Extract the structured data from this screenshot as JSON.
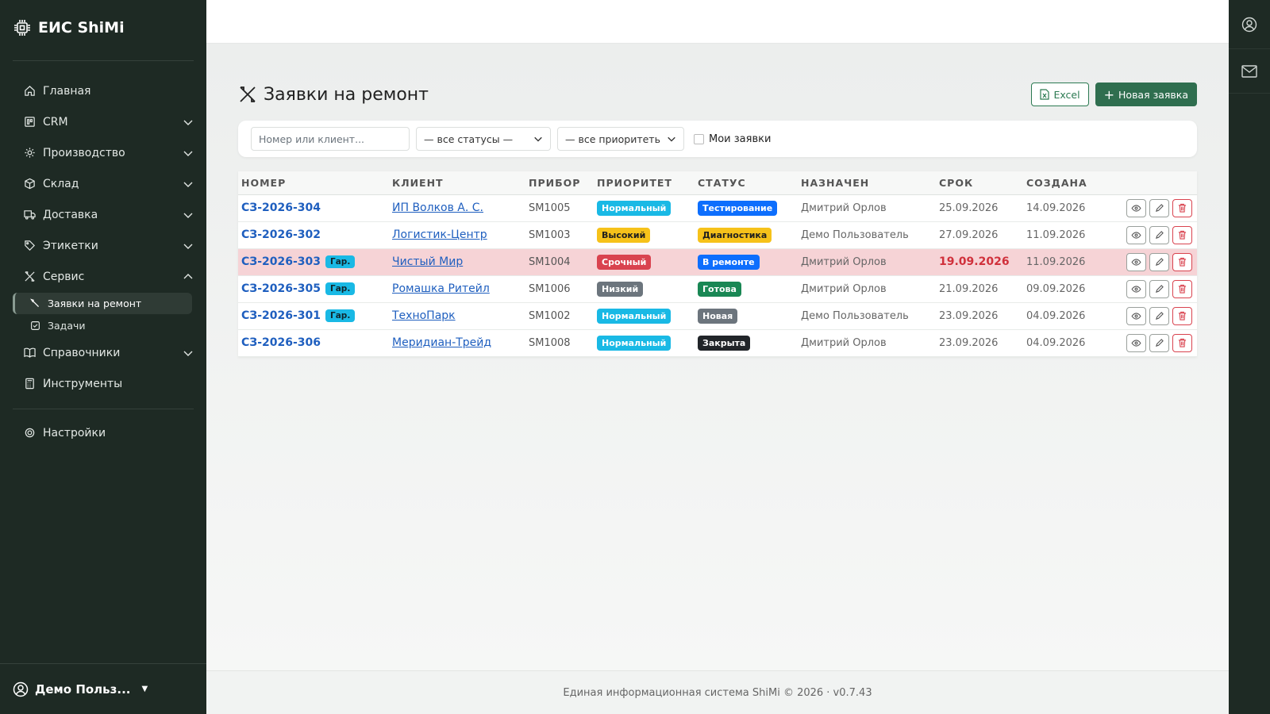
{
  "app": {
    "title": "ЕИС ShiMi"
  },
  "sidebar": {
    "items": [
      {
        "label": "Главная",
        "icon": "home-icon"
      },
      {
        "label": "CRM",
        "icon": "crm-icon"
      },
      {
        "label": "Производство",
        "icon": "gear-icon"
      },
      {
        "label": "Склад",
        "icon": "box-icon"
      },
      {
        "label": "Доставка",
        "icon": "truck-icon"
      },
      {
        "label": "Этикетки",
        "icon": "tag-icon"
      },
      {
        "label": "Сервис",
        "icon": "tools-icon"
      },
      {
        "label": "Заявки на ремонт",
        "icon": "wrench-icon"
      },
      {
        "label": "Задачи",
        "icon": "checkbox-icon"
      },
      {
        "label": "Справочники",
        "icon": "book-icon"
      },
      {
        "label": "Инструменты",
        "icon": "calculator-icon"
      },
      {
        "label": "Настройки",
        "icon": "settings-icon"
      }
    ],
    "user": "Демо Польз..."
  },
  "page": {
    "title": "Заявки на ремонт",
    "excel_label": "Excel",
    "new_label": "Новая заявка"
  },
  "filters": {
    "search_placeholder": "Номер или клиент...",
    "status": "— все статусы —",
    "priority": "— все приоритеть",
    "mine_label": "Мои заявки"
  },
  "table": {
    "headers": [
      "НОМЕР",
      "КЛИЕНТ",
      "ПРИБОР",
      "ПРИОРИТЕТ",
      "СТАТУС",
      "НАЗНАЧЕН",
      "СРОК",
      "СОЗДАНА"
    ],
    "rows": [
      {
        "num": "СЗ-2026-304",
        "gar": "",
        "client": "ИП Волков А. С.",
        "device": "SM1005",
        "priority": "Нормальный",
        "status": "Тестирование",
        "assignee": "Дмитрий Орлов",
        "due": "25.09.2026",
        "created": "14.09.2026"
      },
      {
        "num": "СЗ-2026-302",
        "gar": "",
        "client": "Логистик-Центр",
        "device": "SM1003",
        "priority": "Высокий",
        "status": "Диагностика",
        "assignee": "Демо Пользователь",
        "due": "27.09.2026",
        "created": "11.09.2026"
      },
      {
        "num": "СЗ-2026-303",
        "gar": "Гар.",
        "client": "Чистый Мир",
        "device": "SM1004",
        "priority": "Срочный",
        "status": "В ремонте",
        "assignee": "Дмитрий Орлов",
        "due": "19.09.2026",
        "created": "11.09.2026"
      },
      {
        "num": "СЗ-2026-305",
        "gar": "Гар.",
        "client": "Ромашка Ритейл",
        "device": "SM1006",
        "priority": "Низкий",
        "status": "Готова",
        "assignee": "Дмитрий Орлов",
        "due": "21.09.2026",
        "created": "09.09.2026"
      },
      {
        "num": "СЗ-2026-301",
        "gar": "Гар.",
        "client": "ТехноПарк",
        "device": "SM1002",
        "priority": "Нормальный",
        "status": "Новая",
        "assignee": "Демо Пользователь",
        "due": "23.09.2026",
        "created": "04.09.2026"
      },
      {
        "num": "СЗ-2026-306",
        "gar": "",
        "client": "Меридиан-Трейд",
        "device": "SM1008",
        "priority": "Нормальный",
        "status": "Закрыта",
        "assignee": "Дмитрий Орлов",
        "due": "23.09.2026",
        "created": "04.09.2026"
      }
    ]
  },
  "colors": {
    "sidebar_bg": "#1e2a24",
    "accent_green": "#2f6e4f",
    "link_blue": "#1f5fbf",
    "overdue_red": "#d0303b",
    "urgent_row": "#f6d3d6",
    "priority": {
      "Нормальный": "#19b9e5",
      "Высокий": "#f6c21a",
      "Срочный": "#d9434f",
      "Низкий": "#6c757d"
    },
    "status": {
      "Тестирование": "#0d6efd",
      "Диагностика": "#f6c21a",
      "В ремонте": "#0d6efd",
      "Готова": "#198754",
      "Новая": "#6c757d",
      "Закрыта": "#212529"
    }
  },
  "footer": {
    "text": "Единая информационная система ShiMi © 2026 · v0.7.43"
  }
}
